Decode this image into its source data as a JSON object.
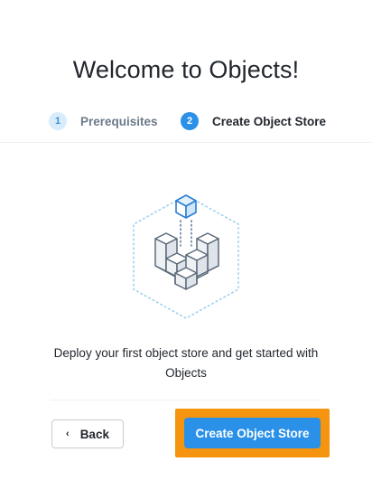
{
  "title": "Welcome to Objects!",
  "steps": [
    {
      "number": "1",
      "label": "Prerequisites",
      "state": "inactive"
    },
    {
      "number": "2",
      "label": "Create Object Store",
      "state": "active"
    }
  ],
  "illustration": {
    "icon": "object-store-cubes-icon"
  },
  "description": "Deploy your first object store and get started with Objects",
  "actions": {
    "back_label": "Back",
    "back_icon": "chevron-left-icon",
    "create_label": "Create Object Store"
  },
  "colors": {
    "primary": "#2b91e8",
    "highlight": "#f5940f",
    "text": "#22272e",
    "muted": "#6b7a89"
  }
}
